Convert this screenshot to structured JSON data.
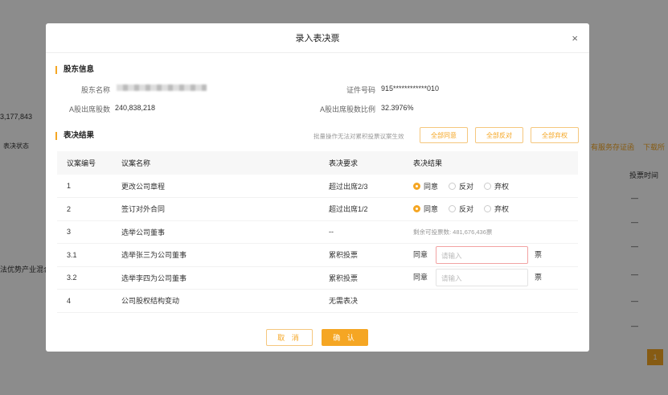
{
  "background": {
    "total": "3,177,843",
    "status_label": "表决状态",
    "row_text": "法优势产业混合",
    "link1": "有服务存证函",
    "link2": "下载所",
    "col_vote_time": "投票时间",
    "dash": "—",
    "page": "1"
  },
  "modal": {
    "title": "录入表决票",
    "close_icon": "×",
    "shareholder": {
      "section": "股东信息",
      "name_label": "股东名称",
      "id_label": "证件号码",
      "id_value": "915************010",
      "shares_label": "A股出席股数",
      "shares_value": "240,838,218",
      "ratio_label": "A股出席股数比例",
      "ratio_value": "32.3976%"
    },
    "result": {
      "section": "表决结果",
      "hint": "批量操作无法对累积投票议案生效",
      "all_agree": "全部同意",
      "all_oppose": "全部反对",
      "all_abstain": "全部弃权"
    },
    "table": {
      "headers": [
        "议案编号",
        "议案名称",
        "表决要求",
        "表决结果"
      ],
      "rows": [
        {
          "no": "1",
          "name": "更改公司章程",
          "req": "超过出席2/3",
          "type": "radio",
          "selected": "同意"
        },
        {
          "no": "2",
          "name": "签订对外合同",
          "req": "超过出席1/2",
          "type": "radio",
          "selected": "同意"
        },
        {
          "no": "3",
          "name": "选举公司董事",
          "req": "--",
          "type": "remain",
          "remain": "剩余可投票数: 481,676,436票"
        },
        {
          "no": "3.1",
          "name": "选举张三为公司董事",
          "req": "累积投票",
          "type": "input",
          "error": true
        },
        {
          "no": "3.2",
          "name": "选举李四为公司董事",
          "req": "累积投票",
          "type": "input",
          "error": false
        },
        {
          "no": "4",
          "name": "公司股权结构变动",
          "req": "无需表决",
          "type": "none"
        }
      ]
    },
    "options": [
      "同意",
      "反对",
      "弃权"
    ],
    "agree_label": "同意",
    "unit": "票",
    "placeholder": "请输入",
    "cancel": "取 消",
    "confirm": "确 认"
  },
  "colors": {
    "accent": "#f5a623"
  }
}
